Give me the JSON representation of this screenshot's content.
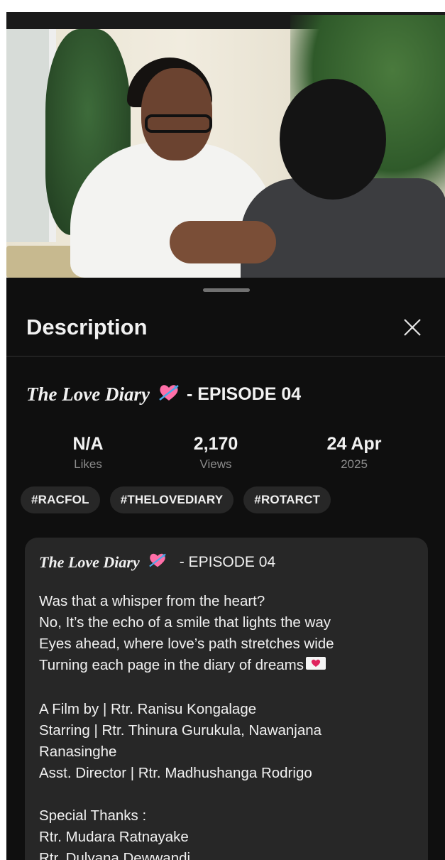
{
  "sheet": {
    "title": "Description",
    "close_icon": "close-icon"
  },
  "video": {
    "title_script": "The Love Diary",
    "title_emoji": "heart-with-arrow",
    "title_episode": "- EPISODE 04"
  },
  "stats": {
    "likes": {
      "value": "N/A",
      "label": "Likes"
    },
    "views": {
      "value": "2,170",
      "label": "Views"
    },
    "date": {
      "value": "24 Apr",
      "label": "2025"
    }
  },
  "tags": [
    "#RACFOL",
    "#THELOVEDIARY",
    "#ROTARCT"
  ],
  "description": {
    "head_script": "The Love Diary",
    "head_episode": "- EPISODE 04",
    "poem": [
      "Was that a whisper from the heart?",
      "No, It’s the echo of a smile that lights the way",
      "Eyes ahead, where love’s path stretches wide",
      "Turning each page in the diary of dreams"
    ],
    "credits": [
      "A Film by | Rtr. Ranisu Kongalage",
      "Starring | Rtr. Thinura Gurukula, Nawanjana",
      "Ranasinghe",
      "Asst. Director | Rtr. Madhushanga Rodrigo"
    ],
    "thanks": [
      "Special Thanks :",
      "Rtr. Mudara Ratnayake",
      "Rtr. Dulyana Dewwandi"
    ]
  },
  "colors": {
    "background": "#0f0f0f",
    "card": "#272727",
    "heart_pink": "#ff6fa8",
    "muted_text": "#8b8b8b"
  }
}
